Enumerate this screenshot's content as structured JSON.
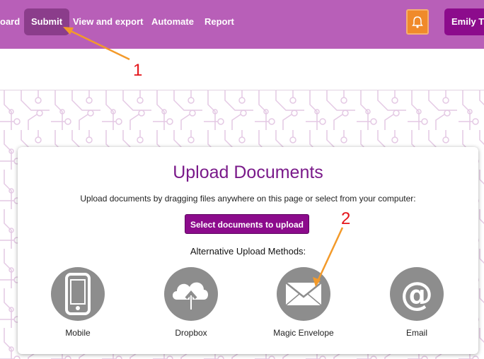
{
  "nav": {
    "items": [
      "oard",
      "Submit",
      "View and export",
      "Automate",
      "Report"
    ],
    "active": "Submit",
    "user_label": "Emily Tib",
    "notification_icon": "bell-icon"
  },
  "upload": {
    "title": "Upload Documents",
    "instructions": "Upload documents by dragging files anywhere on this page or select from your computer:",
    "select_button": "Select documents to upload",
    "alt_heading": "Alternative Upload Methods:",
    "methods": [
      {
        "label": "Mobile",
        "icon": "mobile-phone-icon"
      },
      {
        "label": "Dropbox",
        "icon": "cloud-upload-icon"
      },
      {
        "label": "Magic Envelope",
        "icon": "envelope-icon"
      },
      {
        "label": "Email",
        "icon": "at-sign-icon"
      }
    ]
  },
  "annotations": [
    "1",
    "2"
  ],
  "colors": {
    "topbar": "#b85fb8",
    "active_nav": "#8b3d8b",
    "primary": "#8c0b8c",
    "bell": "#f08a2a",
    "arrow": "#f39a2a",
    "annotation_text": "#e4141a"
  }
}
